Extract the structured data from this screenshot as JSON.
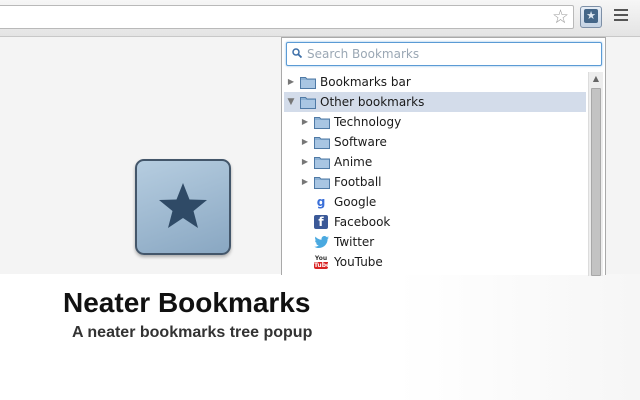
{
  "toolbar": {
    "star_icon": "star-outline-icon",
    "extension_icon": "neater-bookmarks-icon",
    "menu_icon": "hamburger-menu-icon"
  },
  "app": {
    "title": "Neater Bookmarks",
    "subtitle": "A neater bookmarks tree popup"
  },
  "popup": {
    "search_placeholder": "Search Bookmarks",
    "tree": [
      {
        "label": "Bookmarks bar",
        "type": "folder",
        "depth": 0,
        "expanded": false,
        "selected": false
      },
      {
        "label": "Other bookmarks",
        "type": "folder",
        "depth": 0,
        "expanded": true,
        "selected": true
      },
      {
        "label": "Technology",
        "type": "folder",
        "depth": 1,
        "expanded": false,
        "selected": false
      },
      {
        "label": "Software",
        "type": "folder",
        "depth": 1,
        "expanded": false,
        "selected": false
      },
      {
        "label": "Anime",
        "type": "folder",
        "depth": 1,
        "expanded": false,
        "selected": false
      },
      {
        "label": "Football",
        "type": "folder",
        "depth": 1,
        "expanded": false,
        "selected": false
      },
      {
        "label": "Google",
        "type": "bookmark",
        "depth": 1,
        "icon": "google-favicon"
      },
      {
        "label": "Facebook",
        "type": "bookmark",
        "depth": 1,
        "icon": "facebook-favicon"
      },
      {
        "label": "Twitter",
        "type": "bookmark",
        "depth": 1,
        "icon": "twitter-favicon"
      },
      {
        "label": "YouTube",
        "type": "bookmark",
        "depth": 1,
        "icon": "youtube-favicon"
      }
    ]
  },
  "colors": {
    "selection": "#d3dcea",
    "search_border": "#5b9bd5",
    "hero_icon": "#89a7c2",
    "star": "#2f4a66"
  }
}
